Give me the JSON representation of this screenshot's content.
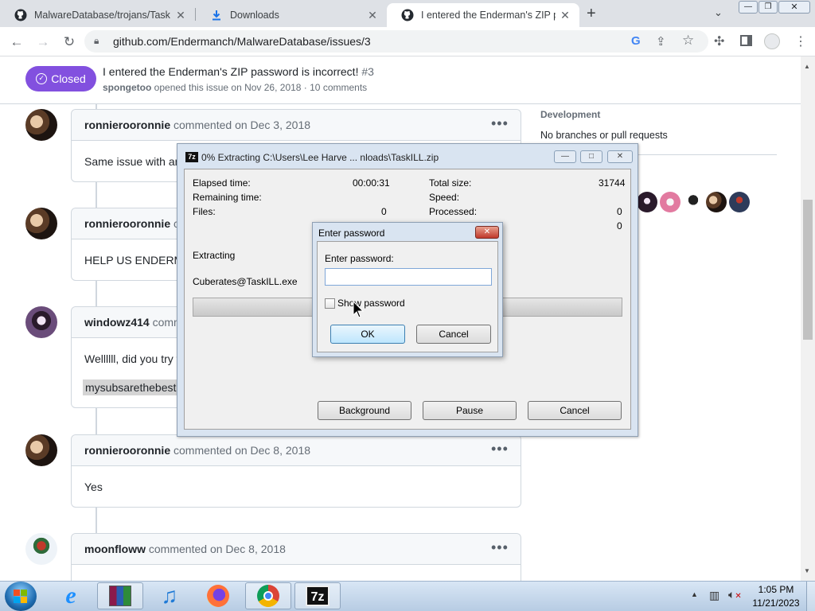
{
  "browser": {
    "tabs": [
      {
        "label": "MalwareDatabase/trojans/TaskILL",
        "icon": "github-icon"
      },
      {
        "label": "Downloads",
        "icon": "download-icon"
      },
      {
        "label": "I entered the Enderman's ZIP pas",
        "icon": "github-icon",
        "active": true
      }
    ],
    "new_tab": "+",
    "url": "github.com/Endermanch/MalwareDatabase/issues/3"
  },
  "issue": {
    "status": "Closed",
    "title": "I entered the Enderman's ZIP password is incorrect!",
    "number": "#3",
    "author": "spongetoo",
    "meta": "opened this issue on Nov 26, 2018 · 10 comments"
  },
  "comments": [
    {
      "author": "ronnierooronnie",
      "verb": "commented",
      "date": "on Dec 3, 2018",
      "body": "Same issue with an"
    },
    {
      "author": "ronnierooronnie",
      "verb": "co",
      "date": "",
      "body": "HELP US ENDERMA"
    },
    {
      "author": "windowz414",
      "verb": "comm",
      "date": "",
      "body": "Wellllll, did you try t",
      "code": "mysubsarethebest"
    },
    {
      "author": "ronnierooronnie",
      "verb": "commented",
      "date": "on Dec 8, 2018",
      "body": "Yes"
    },
    {
      "author": "moonfloww",
      "verb": "commented",
      "date": "on Dec 8, 2018",
      "body": ""
    }
  ],
  "sidebar": {
    "development_heading": "Development",
    "development_text": "No branches or pull requests"
  },
  "zip_dialog": {
    "title": "0% Extracting C:\\Users\\Lee Harve ... nloads\\TaskILL.zip",
    "elapsed_label": "Elapsed time:",
    "elapsed_value": "00:00:31",
    "remaining_label": "Remaining time:",
    "files_label": "Files:",
    "files_value": "0",
    "total_label": "Total size:",
    "total_value": "31744",
    "speed_label": "Speed:",
    "processed_label": "Processed:",
    "processed_value": "0",
    "extra_value": "0",
    "extracting_label": "Extracting",
    "current_file": "Cuberates@TaskILL.exe",
    "background_button": "Background",
    "pause_button": "Pause",
    "cancel_button": "Cancel",
    "progress": 0
  },
  "password_dialog": {
    "title": "Enter password",
    "prompt": "Enter password:",
    "value": "",
    "show_password_label": "Show password",
    "show_password_checked": false,
    "ok_button": "OK",
    "cancel_button": "Cancel"
  },
  "taskbar": {
    "time": "1:05 PM",
    "date": "11/21/2023",
    "apps": [
      "start-orb",
      "internet-explorer",
      "winrar",
      "media-player",
      "firefox",
      "chrome",
      "7zip"
    ]
  }
}
